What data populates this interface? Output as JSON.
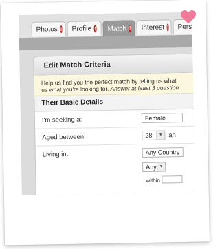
{
  "tabs": [
    {
      "label": "Photos",
      "badge": "!"
    },
    {
      "label": "Profile",
      "badge": "!"
    },
    {
      "label": "Match",
      "badge": "!"
    },
    {
      "label": "Interest",
      "badge": "!"
    },
    {
      "label": "Perso"
    }
  ],
  "panel": {
    "title": "Edit Match Criteria",
    "intro_line1": "Help us find you the perfect match by telling us what",
    "intro_line2": "us what you're looking for.",
    "intro_italic": "Answer at least 3 question",
    "section_title": "Their Basic Details"
  },
  "fields": {
    "seeking_label": "I'm seeking a:",
    "seeking_value": "Female",
    "age_label": "Aged between:",
    "age_value": "28",
    "age_joiner": "an",
    "living_label": "Living in:",
    "country_value": "Any Country",
    "region_value": "Any",
    "within_label": "within"
  },
  "colors": {
    "badge": "#c8201c",
    "heart": "#f07a9a",
    "intro_bg": "#fbf8df"
  }
}
